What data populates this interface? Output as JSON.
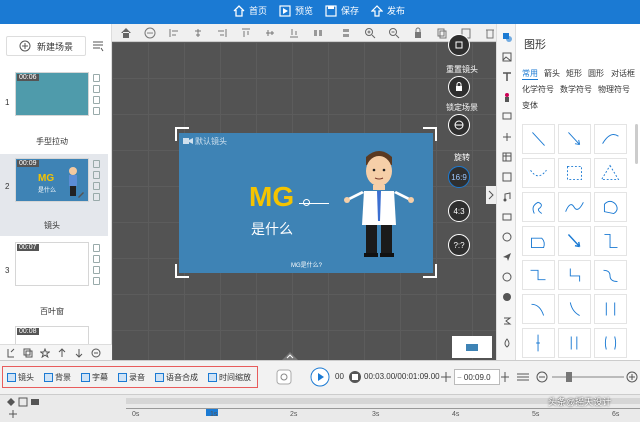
{
  "topbar": {
    "home": "首页",
    "preview": "预览",
    "save": "保存",
    "publish": "发布"
  },
  "left": {
    "new_scene": "新建场景",
    "scenes": [
      {
        "num": "1",
        "time": "00:06",
        "label": "手型拉动"
      },
      {
        "num": "2",
        "time": "00:09",
        "label": "镜头",
        "thumb": "MG\n是什么"
      },
      {
        "num": "3",
        "time": "00:07",
        "label": "百叶窗"
      },
      {
        "time": "00:08"
      }
    ]
  },
  "stage": {
    "camera_label": "默认镜头",
    "title_big": "MG",
    "title_sub": "是什么",
    "caption": "MG是什么?"
  },
  "canvas_side": {
    "reset_camera": "重置镜头",
    "lock_scene": "锁定场景",
    "rotate": "旋转",
    "r169": "16:9",
    "r43": "4:3",
    "rq": "?:?"
  },
  "shapes": {
    "title": "图形",
    "categories": [
      "常用",
      "箭头",
      "矩形",
      "圆形",
      "对话框",
      "化学符号",
      "数学符号",
      "物理符号",
      "变体"
    ],
    "active_category": "常用"
  },
  "bottom": {
    "tools": [
      "镜头",
      "背景",
      "字幕",
      "录音",
      "语音合成",
      "时间缩放"
    ],
    "time_display": "00:03.00/00:01:09.00",
    "time_short": "00",
    "duration": "00:09.0"
  },
  "ruler": [
    "0s",
    "1s",
    "2s",
    "3s",
    "4s",
    "5s",
    "6s"
  ],
  "watermark": "头条@摇天设计",
  "colors": {
    "accent": "#1b7ad3",
    "stage": "#3e83b5",
    "highlight": "#e85c5c"
  }
}
